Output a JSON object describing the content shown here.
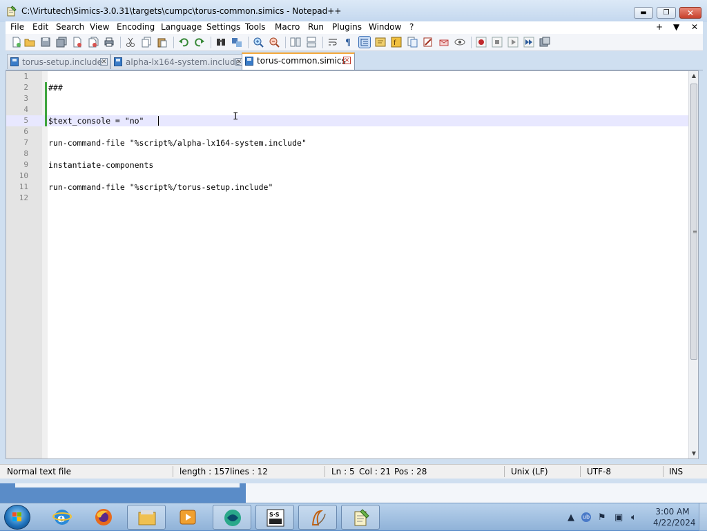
{
  "window": {
    "title": "C:\\Virtutech\\Simics-3.0.31\\targets\\cumpc\\torus-common.simics - Notepad++",
    "buttons": {
      "minimize": "▬",
      "maximize": "❐",
      "close": "✕"
    }
  },
  "menu": {
    "items": [
      "File",
      "Edit",
      "Search",
      "View",
      "Encoding",
      "Language",
      "Settings",
      "Tools",
      "Macro",
      "Run",
      "Plugins",
      "Window",
      "?"
    ],
    "right": [
      "+",
      "▼",
      "✕"
    ]
  },
  "toolbar": {
    "icons": [
      "new-file-icon",
      "open-file-icon",
      "save-icon",
      "save-all-icon",
      "close-icon",
      "close-all-icon",
      "print-icon",
      "cut-icon",
      "copy-icon",
      "paste-icon",
      "undo-icon",
      "redo-icon",
      "find-icon",
      "replace-icon",
      "zoom-in-icon",
      "zoom-out-icon",
      "sync-vertical-icon",
      "sync-horizontal-icon",
      "word-wrap-icon",
      "show-all-chars-icon",
      "indent-guide-icon",
      "udl-icon",
      "function-list-icon",
      "doc-map-icon",
      "folder-workspace-icon",
      "monitor-icon",
      "eye-icon",
      "record-macro-icon",
      "stop-macro-icon",
      "play-macro-icon",
      "run-macro-multiple-icon",
      "save-macro-icon"
    ]
  },
  "tabs": [
    {
      "label": "torus-setup.include",
      "active": false
    },
    {
      "label": "alpha-lx164-system.include",
      "active": false
    },
    {
      "label": "torus-common.simics",
      "active": true
    }
  ],
  "editor": {
    "lines": [
      {
        "n": "1",
        "text": ""
      },
      {
        "n": "2",
        "text": "###"
      },
      {
        "n": "3",
        "text": ""
      },
      {
        "n": "4",
        "text": ""
      },
      {
        "n": "5",
        "text": "$text_console = \"no\""
      },
      {
        "n": "6",
        "text": ""
      },
      {
        "n": "7",
        "text": "run-command-file \"%script%/alpha-lx164-system.include\""
      },
      {
        "n": "8",
        "text": ""
      },
      {
        "n": "9",
        "text": "instantiate-components"
      },
      {
        "n": "10",
        "text": ""
      },
      {
        "n": "11",
        "text": "run-command-file \"%script%/torus-setup.include\""
      },
      {
        "n": "12",
        "text": ""
      }
    ],
    "current_line": 5,
    "changed_lines": [
      2,
      3,
      4,
      5
    ]
  },
  "status": {
    "file_type": "Normal text file",
    "length": "length : 157",
    "lines": "lines : 12",
    "ln": "Ln : 5",
    "col": "Col : 21",
    "pos": "Pos : 28",
    "eol": "Unix (LF)",
    "encoding": "UTF-8",
    "mode": "INS"
  },
  "taskbar": {
    "apps": [
      "internet-explorer-icon",
      "firefox-icon",
      "file-explorer-icon",
      "media-player-icon",
      "app-globe-icon",
      "sands-group-icon",
      "app-swoosh-icon",
      "notepadpp-icon"
    ],
    "clock_time": "3:00 AM",
    "clock_date": "4/22/2024"
  },
  "colors": {
    "accent_tab": "#f4a83a",
    "current_line": "#e8e8ff",
    "change_marker": "#3fa53f",
    "desktop": "#5a8cc8"
  }
}
